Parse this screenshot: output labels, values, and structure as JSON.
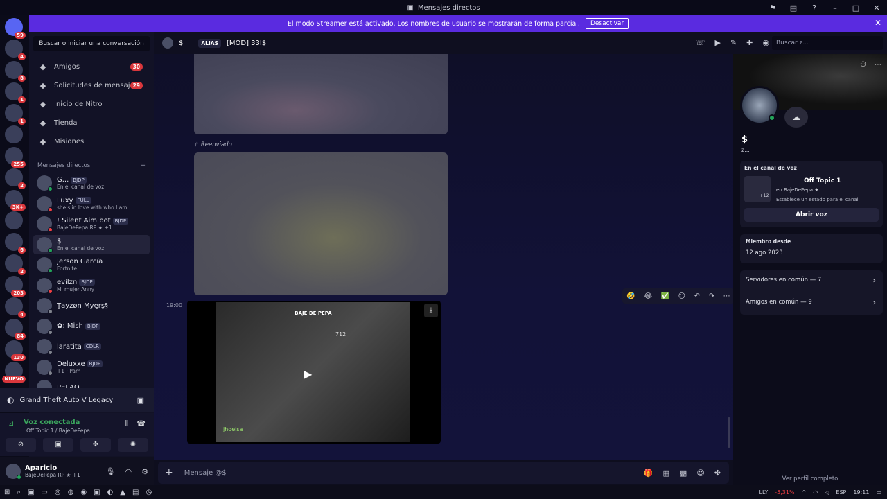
{
  "window": {
    "title": "Mensajes directos"
  },
  "streamer_banner": {
    "text": "El modo Streamer está activado. Los nombres de usuario se mostrarán de forma parcial.",
    "button": "Desactivar"
  },
  "servers": [
    {
      "badge": "59"
    },
    {
      "badge": "4"
    },
    {
      "badge": "8"
    },
    {
      "badge": "1"
    },
    {
      "badge": "1"
    },
    {
      "badge": ""
    },
    {
      "badge": "255"
    },
    {
      "badge": "2"
    },
    {
      "badge": "3K+"
    },
    {
      "badge": ""
    },
    {
      "badge": "6"
    },
    {
      "badge": "2"
    },
    {
      "badge": "203"
    },
    {
      "badge": "4"
    },
    {
      "badge": "84"
    },
    {
      "badge": "130"
    },
    {
      "badge": "NUEVO"
    }
  ],
  "dm_panel": {
    "search_placeholder": "Buscar o iniciar una conversación",
    "nav": [
      {
        "icon": "friends-icon",
        "label": "Amigos",
        "count": "30"
      },
      {
        "icon": "mail-icon",
        "label": "Solicitudes de mensaj...",
        "count": "29"
      },
      {
        "icon": "nitro-icon",
        "label": "Inicio de Nitro",
        "count": ""
      },
      {
        "icon": "shop-icon",
        "label": "Tienda",
        "count": ""
      },
      {
        "icon": "quests-icon",
        "label": "Misiones",
        "count": ""
      }
    ],
    "dm_header": "Mensajes directos",
    "dms": [
      {
        "name": "G...",
        "tag": "BJDP",
        "status": "En el canal de voz",
        "dot": "#23a55a"
      },
      {
        "name": "Luxy",
        "tag": "FULL",
        "status": "she's in love with who I am",
        "dot": "#f23f43"
      },
      {
        "name": "! Silent Aim bot",
        "tag": "BJDP",
        "status": "BajeDePepa RP ★ +1",
        "dot": "#f23f43"
      },
      {
        "name": "$",
        "tag": "",
        "status": "En el canal de voz",
        "dot": "#23a55a"
      },
      {
        "name": "Jerson García",
        "tag": "",
        "status": "Fortnite",
        "dot": "#23a55a"
      },
      {
        "name": "evilzn",
        "tag": "BJDP",
        "status": "Mi mujer Anny",
        "dot": "#f23f43"
      },
      {
        "name": "Ţayzøn Myęrş§",
        "tag": "",
        "status": "",
        "dot": "#80848e"
      },
      {
        "name": "✿: Mish",
        "tag": "BJDP",
        "status": "",
        "dot": "#80848e"
      },
      {
        "name": "laratita",
        "tag": "CDLR",
        "status": "",
        "dot": "#80848e"
      },
      {
        "name": "Deluxxe",
        "tag": "BJDP",
        "status": "+1 · Pam",
        "dot": "#80848e"
      },
      {
        "name": "PELAO",
        "tag": "",
        "status": "",
        "dot": "#80848e"
      }
    ],
    "game_activity": "Grand Theft Auto V Legacy",
    "voice": {
      "state": "Voz conectada",
      "channel": "Off Topic 1 / BajeDePepa ..."
    },
    "user": {
      "name": "Aparicio",
      "status": "BajeDePepa RP ★ +1"
    }
  },
  "chat_header": {
    "name": "$",
    "alias_tag": "ALIAS",
    "alias": "[MOD] 33I$",
    "search_placeholder": "Buscar z..."
  },
  "chat": {
    "forwarded_label": "Reenviado",
    "time": "19:00",
    "video": {
      "title": "BAJE DE PEPA",
      "number": "712",
      "player": "jhoelsa"
    },
    "composer_placeholder": "Mensaje @$"
  },
  "profile": {
    "name": "$",
    "sub": "z...",
    "voice_card": {
      "heading": "En el canal de voz",
      "channel": "Off Topic 1",
      "server": "en BajeDePepa ★",
      "hint": "Establece un estado para el canal",
      "more": "+12",
      "button": "Abrir voz"
    },
    "member_since": {
      "heading": "Miembro desde",
      "date": "12 ago 2023"
    },
    "links": [
      {
        "label": "Servidores en común — 7"
      },
      {
        "label": "Amigos en común — 9"
      }
    ],
    "full_profile": "Ver perfil completo"
  },
  "taskbar": {
    "ticker": "LLY",
    "change": "-5,31%",
    "lang": "ESP",
    "time": "19:11"
  }
}
